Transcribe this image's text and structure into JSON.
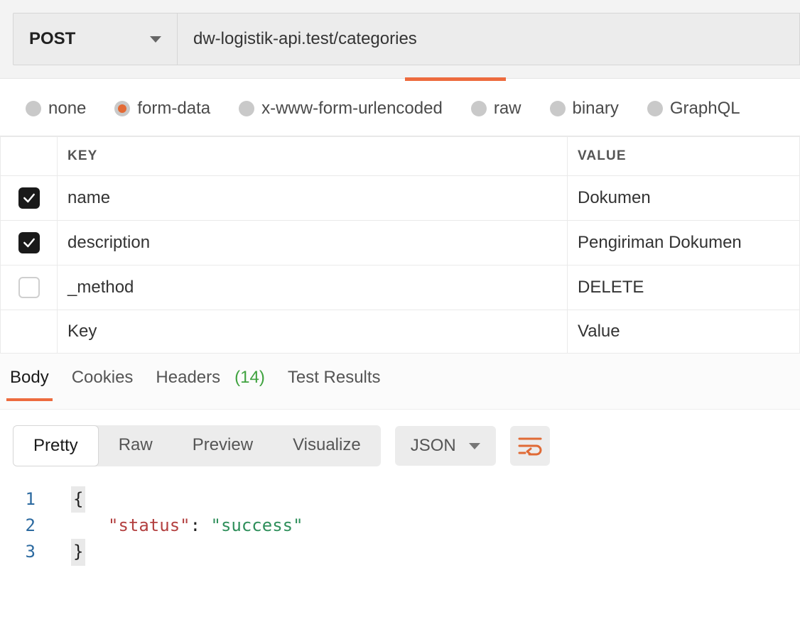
{
  "request": {
    "method": "POST",
    "url": "dw-logistik-api.test/categories"
  },
  "body_types": [
    {
      "label": "none",
      "selected": false
    },
    {
      "label": "form-data",
      "selected": true
    },
    {
      "label": "x-www-form-urlencoded",
      "selected": false
    },
    {
      "label": "raw",
      "selected": false
    },
    {
      "label": "binary",
      "selected": false
    },
    {
      "label": "GraphQL",
      "selected": false
    }
  ],
  "params_header": {
    "key": "KEY",
    "value": "VALUE"
  },
  "params": [
    {
      "enabled": true,
      "key": "name",
      "value": "Dokumen"
    },
    {
      "enabled": true,
      "key": "description",
      "value": "Pengiriman Dokumen"
    },
    {
      "enabled": false,
      "key": "_method",
      "value": "DELETE"
    }
  ],
  "params_placeholder": {
    "key": "Key",
    "value": "Value"
  },
  "response_tabs": {
    "body": "Body",
    "cookies": "Cookies",
    "headers": "Headers",
    "headers_count": "(14)",
    "test_results": "Test Results"
  },
  "view_modes": {
    "pretty": "Pretty",
    "raw": "Raw",
    "preview": "Preview",
    "visualize": "Visualize",
    "format": "JSON"
  },
  "response_json": {
    "line1_num": "1",
    "line1_text": "{",
    "line2_num": "2",
    "line2_key_quoted": "\"status\"",
    "line2_colon": ":",
    "line2_val_quoted": "\"success\"",
    "line3_num": "3",
    "line3_text": "}"
  }
}
